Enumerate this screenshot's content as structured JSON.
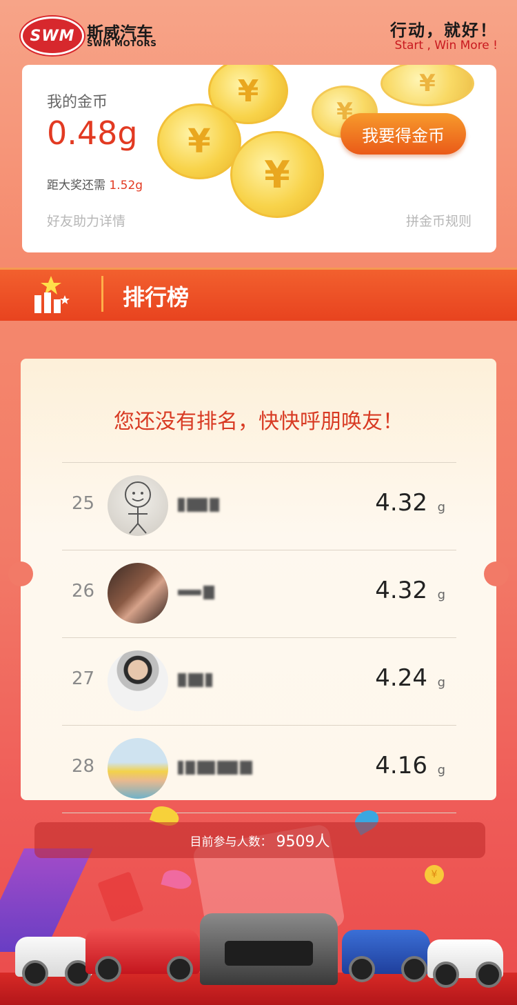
{
  "header": {
    "logo_text": "SWM",
    "brand_cn": "斯威汽车",
    "brand_en": "SWM MOTORS",
    "slogan_cn": "行动，就好！",
    "slogan_en": "Start , Win More !"
  },
  "coin_card": {
    "label": "我的金币",
    "value": "0.48g",
    "remain_prefix": "距大奖还需",
    "remain_value": "1.52g",
    "get_button": "我要得金币",
    "friends_link": "好友助力详情",
    "rules_link": "拼金币规则",
    "coin_symbol": "¥"
  },
  "ranking": {
    "title": "排行榜",
    "no_rank_message": "您还没有排名，快快呼朋唤友！",
    "unit": "g",
    "rows": [
      {
        "rank": "25",
        "score": "4.32"
      },
      {
        "rank": "26",
        "score": "4.32"
      },
      {
        "rank": "27",
        "score": "4.24"
      },
      {
        "rank": "28",
        "score": "4.16"
      }
    ]
  },
  "participants": {
    "label": "目前参与人数：",
    "count": "9509人"
  },
  "colors": {
    "accent_red": "#e23a22",
    "button_orange": "#ea5a18",
    "rank_bar": "#e8431f"
  }
}
